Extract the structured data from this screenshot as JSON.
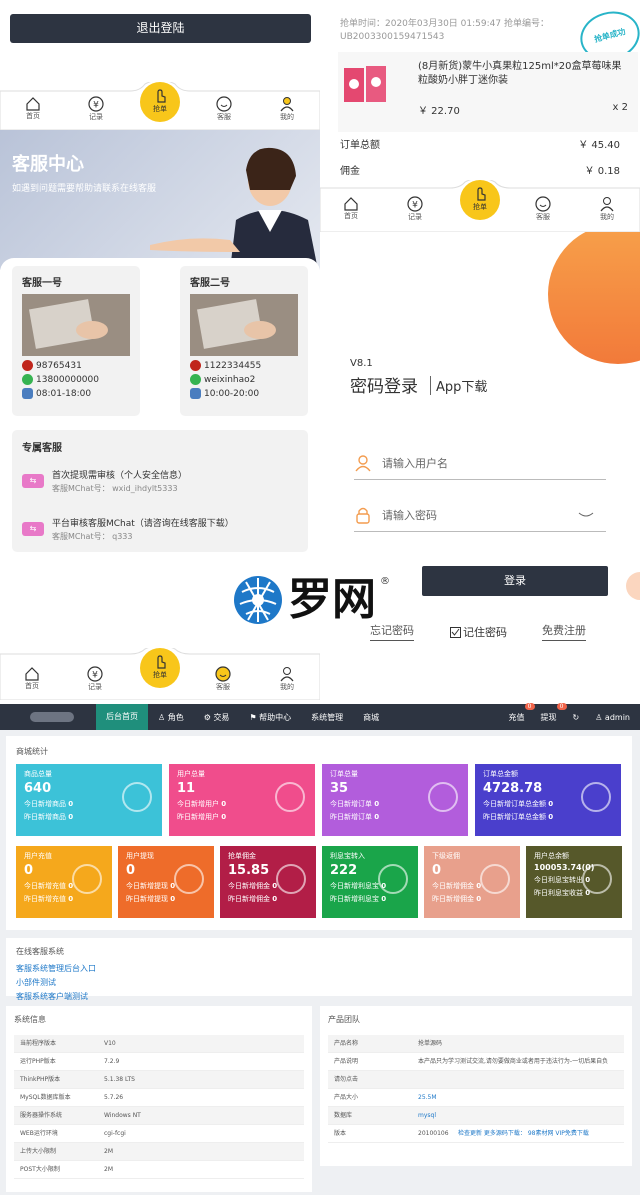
{
  "colors": {
    "dark": "#2d3441",
    "accent": "#f8c61a",
    "orange": "#f39c4f",
    "blue": "#1e78c8",
    "green": "#36b351"
  },
  "logout": {
    "label": "退出登陆"
  },
  "nav_top": {
    "home": "首页",
    "record": "记录",
    "grab": "抢单",
    "service": "客服",
    "mine": "我的"
  },
  "service": {
    "title": "客服中心",
    "subtitle": "如遇到问题需要帮助请联系在线客服",
    "agents": [
      {
        "name": "客服一号",
        "qq": "98765431",
        "phone": "13800000000",
        "hours": "08:01-18:00"
      },
      {
        "name": "客服二号",
        "qq": "1122334455",
        "wechat": "weixinhao2",
        "hours": "10:00-20:00"
      }
    ],
    "exclusive_title": "专属客服",
    "exclusive": [
      {
        "title": "首次提现需审核（个人安全信息）",
        "sub": "客服MChat号： wxid_ihdylt5333"
      },
      {
        "title": "平台审核客服MChat（请咨询在线客服下载）",
        "sub": "客服MChat号： q333"
      }
    ]
  },
  "order": {
    "time": "抢单时间：2020年03月30日 01:59:47 抢单编号：",
    "number": "UB2003300159471543",
    "stamp": "抢单成功",
    "product": "(8月新货)蒙牛小真果粒125ml*20盒草莓味果粒酸奶小胖丁迷你装",
    "price": "￥ 22.70",
    "qty": "x 2",
    "total_label": "订单总额",
    "total": "￥ 45.40",
    "commission_label": "佣金",
    "commission": "￥ 0.18"
  },
  "login": {
    "version": "V8.1",
    "title": "密码登录",
    "app": "App下载",
    "user_placeholder": "请输入用户名",
    "pass_placeholder": "请输入密码",
    "login_button": "登录",
    "forgot": "忘记密码",
    "remember": "记住密码",
    "register": "免费注册"
  },
  "logo": {
    "text": "罗网",
    "reg": "®"
  },
  "admin": {
    "nav": [
      "后台首页",
      "角色",
      "交易",
      "帮助中心",
      "系统管理",
      "商城"
    ],
    "recharge": "充值",
    "recharge_badge": "0",
    "withdraw": "提现",
    "withdraw_badge": "0",
    "user": "admin",
    "stats_title": "商城统计",
    "cards": [
      {
        "title": "商品总量",
        "value": "640",
        "l1": "今日新增商品",
        "v1": "0",
        "l2": "昨日新增商品",
        "v2": "0",
        "color": "#3cc2d8"
      },
      {
        "title": "用户总量",
        "value": "11",
        "l1": "今日新增用户",
        "v1": "0",
        "l2": "昨日新增用户",
        "v2": "0",
        "color": "#f04d8c"
      },
      {
        "title": "订单总量",
        "value": "35",
        "l1": "今日新增订单",
        "v1": "0",
        "l2": "昨日新增订单",
        "v2": "0",
        "color": "#b25ddc"
      },
      {
        "title": "订单总金额",
        "value": "4728.78",
        "l1": "今日新增订单总金额",
        "v1": "0",
        "l2": "昨日新增订单总金额",
        "v2": "0",
        "color": "#4a3fcc"
      }
    ],
    "cards2": [
      {
        "title": "用户充值",
        "value": "0",
        "l1": "今日新增充值",
        "v1": "0",
        "l2": "昨日新增充值",
        "v2": "0",
        "color": "#f5a81c"
      },
      {
        "title": "用户提现",
        "value": "0",
        "l1": "今日新增提现",
        "v1": "0",
        "l2": "昨日新增提现",
        "v2": "0",
        "color": "#ee6c2a"
      },
      {
        "title": "抢单佣金",
        "value": "15.85",
        "l1": "今日新增佣金",
        "v1": "0",
        "l2": "昨日新增佣金",
        "v2": "0",
        "color": "#b21e47"
      },
      {
        "title": "利息宝转入",
        "value": "222",
        "l1": "今日新增利息宝",
        "v1": "0",
        "l2": "昨日新增利息宝",
        "v2": "0",
        "color": "#1aa54a"
      },
      {
        "title": "下级返佣",
        "value": "0",
        "l1": "今日新增佣金",
        "v1": "0",
        "l2": "昨日新增佣金",
        "v2": "0",
        "color": "#e8a08c"
      },
      {
        "title": "用户总余额",
        "value": "100053.74(0)",
        "l1": "今日利息宝转出",
        "v1": "0",
        "l2": "昨日利息宝收益",
        "v2": "0",
        "color": "#56582a"
      }
    ],
    "online_title": "在线客服系统",
    "online_links": [
      "客服系统管理后台入口",
      "小部件测试",
      "客服系统客户端测试"
    ],
    "sys_title": "系统信息",
    "sys_rows": [
      [
        "当前程序版本",
        "V10"
      ],
      [
        "运行PHP版本",
        "7.2.9"
      ],
      [
        "ThinkPHP版本",
        "5.1.38 LTS"
      ],
      [
        "MySQL数据库版本",
        "5.7.26"
      ],
      [
        "服务器操作系统",
        "Windows NT"
      ],
      [
        "WEB运行环境",
        "cgi-fcgi"
      ],
      [
        "上传大小限制",
        "2M"
      ],
      [
        "POST大小限制",
        "2M"
      ]
    ],
    "team_title": "产品团队",
    "team_rows": [
      [
        "产品名称",
        "抢单源码"
      ],
      [
        "产品说明",
        "本产品只为学习测试交流,请勿要做商业或者用于违法行为-一切后果自负"
      ],
      [
        "请勿点击",
        ""
      ],
      [
        "产品大小",
        "25.5M"
      ],
      [
        "数据库",
        "mysql"
      ],
      [
        "版本",
        "20100106"
      ]
    ],
    "version_links": "检查更新 更多源码下载： 98素材网 VIP免费下载"
  }
}
